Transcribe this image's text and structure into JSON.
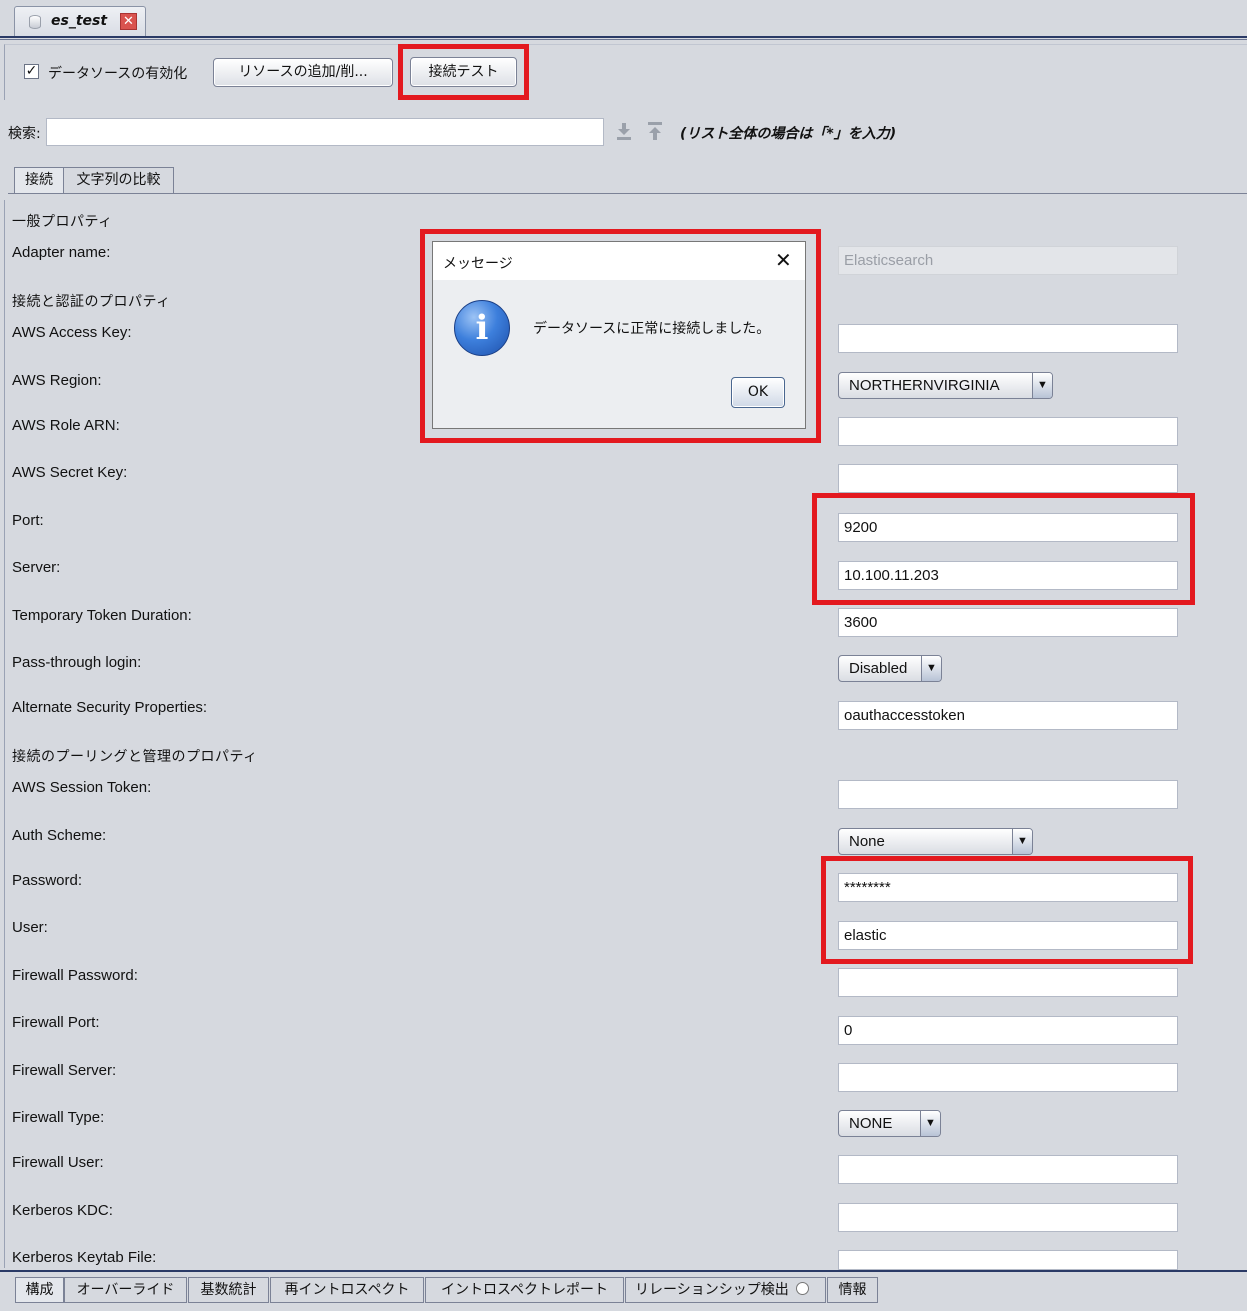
{
  "window_tab": {
    "title": "es_test",
    "close_icon": "close-icon"
  },
  "toolbar": {
    "enable_checkbox_checked": true,
    "enable_label": "データソースの有効化",
    "add_remove_button": "リソースの追加/削...",
    "connect_test_button": "接続テスト"
  },
  "search": {
    "label": "検索:",
    "value": "",
    "hint": "(リスト全体の場合は「*」を入力)"
  },
  "inner_tabs": [
    "接続",
    "文字列の比較"
  ],
  "sections": {
    "general": "一般プロパティ",
    "connection_auth": "接続と認証のプロパティ",
    "pooling": "接続のプーリングと管理のプロパティ"
  },
  "properties": [
    {
      "label": "Adapter name:",
      "value": "Elasticsearch",
      "kind": "disabled"
    },
    {
      "label": "AWS Access Key:",
      "value": "",
      "kind": "text"
    },
    {
      "label": "AWS Region:",
      "value": "NORTHERNVIRGINIA",
      "kind": "select"
    },
    {
      "label": "AWS Role ARN:",
      "value": "",
      "kind": "text"
    },
    {
      "label": "AWS Secret Key:",
      "value": "",
      "kind": "text"
    },
    {
      "label": "Port:",
      "value": "9200",
      "kind": "text"
    },
    {
      "label": "Server:",
      "value": "10.100.11.203",
      "kind": "text"
    },
    {
      "label": "Temporary Token Duration:",
      "value": "3600",
      "kind": "text"
    },
    {
      "label": "Pass-through login:",
      "value": "Disabled",
      "kind": "select"
    },
    {
      "label": "Alternate Security Properties:",
      "value": "oauthaccesstoken",
      "kind": "text"
    },
    {
      "label": "AWS Session Token:",
      "value": "",
      "kind": "text"
    },
    {
      "label": "Auth Scheme:",
      "value": "None",
      "kind": "select"
    },
    {
      "label": "Password:",
      "value": "********",
      "kind": "text"
    },
    {
      "label": "User:",
      "value": "elastic",
      "kind": "text"
    },
    {
      "label": "Firewall Password:",
      "value": "",
      "kind": "text"
    },
    {
      "label": "Firewall Port:",
      "value": "0",
      "kind": "text"
    },
    {
      "label": "Firewall Server:",
      "value": "",
      "kind": "text"
    },
    {
      "label": "Firewall Type:",
      "value": "NONE",
      "kind": "select"
    },
    {
      "label": "Firewall User:",
      "value": "",
      "kind": "text"
    },
    {
      "label": "Kerberos KDC:",
      "value": "",
      "kind": "text"
    },
    {
      "label": "Kerberos Keytab File:",
      "value": "",
      "kind": "text"
    }
  ],
  "dialog": {
    "title": "メッセージ",
    "message": "データソースに正常に接続しました。",
    "ok_button": "OK",
    "icon": "info-icon"
  },
  "bottom_tabs": [
    "構成",
    "オーバーライド",
    "基数統計",
    "再イントロスペクト",
    "イントロスペクトレポート",
    "リレーションシップ検出",
    "情報"
  ],
  "colors": {
    "highlight": "#e3191f",
    "background": "#d6d9df",
    "accent": "#2a3a66"
  }
}
